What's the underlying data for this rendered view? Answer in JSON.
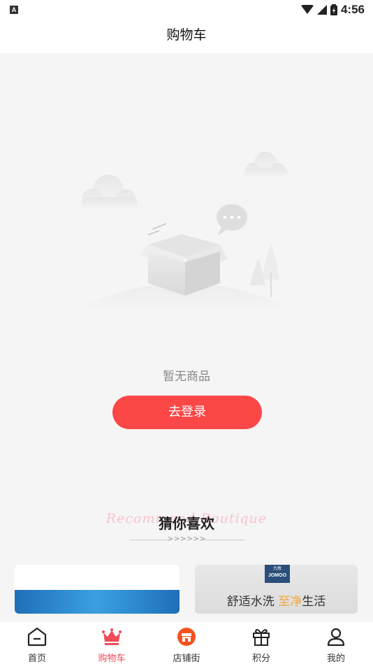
{
  "status_bar": {
    "indicator": "A",
    "time": "4:56",
    "icons": [
      "wifi-icon",
      "signal-icon",
      "battery-charging-icon"
    ]
  },
  "header": {
    "title": "购物车"
  },
  "empty_state": {
    "message": "暂无商品",
    "login_label": "去登录",
    "illustration": "empty-box-icon"
  },
  "recommend": {
    "watermark": "Recommend Boutique",
    "title": "猜你喜欢",
    "arrows": ">>>>>>"
  },
  "products": [
    {
      "brand_cn": "九牧",
      "brand_en": "JOMOO",
      "slogan_a": "舒适水洗 ",
      "slogan_b": "至净",
      "slogan_c": "生活"
    }
  ],
  "tabs": [
    {
      "label": "首页",
      "icon": "home-icon",
      "active": false
    },
    {
      "label": "购物车",
      "icon": "crown-icon",
      "active": true
    },
    {
      "label": "店铺街",
      "icon": "shop-icon",
      "active": false
    },
    {
      "label": "积分",
      "icon": "gift-icon",
      "active": false
    },
    {
      "label": "我的",
      "icon": "user-icon",
      "active": false
    }
  ],
  "colors": {
    "accent": "#fc4747",
    "active_tab": "#ef4a57",
    "background": "#f5f5f5"
  }
}
